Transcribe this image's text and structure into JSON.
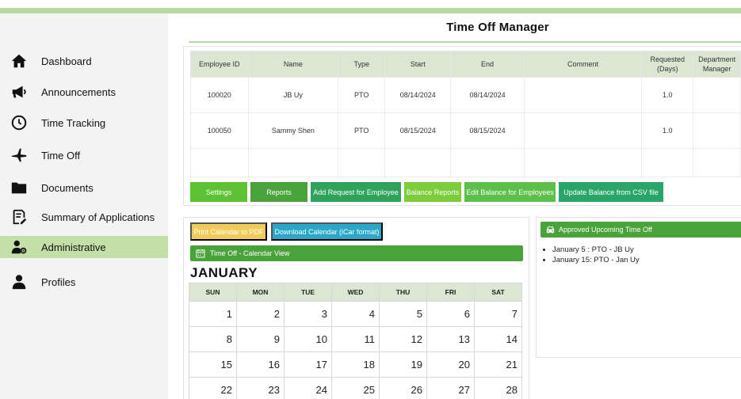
{
  "sidebar": {
    "items": [
      {
        "label": "Dashboard",
        "icon": "home-icon"
      },
      {
        "label": "Announcements",
        "icon": "megaphone-icon"
      },
      {
        "label": "Time Tracking",
        "icon": "clock-icon"
      },
      {
        "label": "Time Off",
        "icon": "airplane-icon"
      },
      {
        "label": "Documents",
        "icon": "folder-icon"
      },
      {
        "label": "Summary of Applications",
        "icon": "document-edit-icon"
      },
      {
        "label": "Administrative",
        "icon": "admin-user-icon",
        "active": true
      },
      {
        "label": "Profiles",
        "icon": "user-icon"
      }
    ]
  },
  "header": {
    "title": "Time Off Manager"
  },
  "requests": {
    "columns": [
      "Employee ID",
      "Name",
      "Type",
      "Start",
      "End",
      "Comment",
      "Requested (Days)",
      "Department Manager"
    ],
    "rows": [
      {
        "id": "100020",
        "name": "JB Uy",
        "type": "PTO",
        "start": "08/14/2024",
        "end": "08/14/2024",
        "comment": "",
        "days": "1.0",
        "manager": ""
      },
      {
        "id": "100050",
        "name": "Sammy Shen",
        "type": "PTO",
        "start": "08/15/2024",
        "end": "08/15/2024",
        "comment": "",
        "days": "1.0",
        "manager": ""
      }
    ]
  },
  "actions": {
    "settings": "Settings",
    "reports": "Reports",
    "add_request": "Add Request for Employee",
    "balance_reports": "Balance Reports",
    "edit_balance": "Edit Balance for Employees",
    "update_balance": "Update Balance from CSV file"
  },
  "calendar": {
    "print_label": "Print Calendar to PDF",
    "download_label": "Download Calendar (iCar format)",
    "header": "Time Off - Calendar View",
    "month": "JANUARY",
    "weekdays": [
      "SUN",
      "MON",
      "TUE",
      "WED",
      "THU",
      "FRI",
      "SAT"
    ],
    "weeks": [
      [
        "1",
        "2",
        "3",
        "4",
        "5",
        "6",
        "7"
      ],
      [
        "8",
        "9",
        "10",
        "11",
        "12",
        "13",
        "14"
      ],
      [
        "15",
        "16",
        "17",
        "18",
        "19",
        "20",
        "21"
      ],
      [
        "22",
        "23",
        "24",
        "25",
        "26",
        "27",
        "28"
      ]
    ]
  },
  "approved": {
    "header": "Approved Upcoming Time Off",
    "items": [
      "January 5 : PTO - JB Uy",
      "January 15: PTO - Jan Uy"
    ]
  },
  "colors": {
    "brand_green": "#4aa33a",
    "light_green": "#b9d9a1",
    "active_nav": "#c5dfa8",
    "yellow": "#f2cb5a",
    "teal_blue": "#2aa8c9"
  }
}
